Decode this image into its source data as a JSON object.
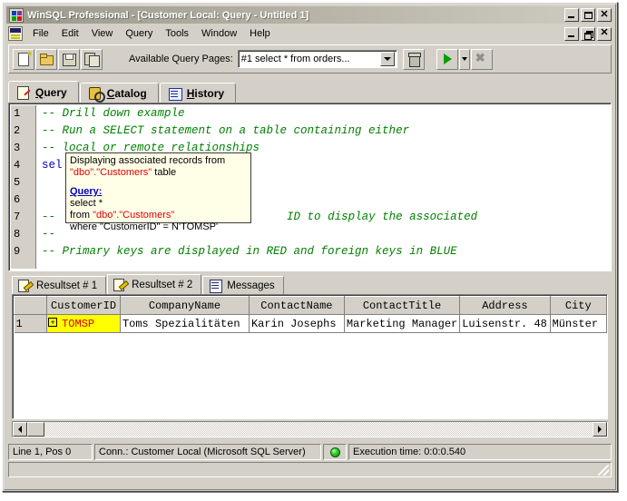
{
  "window": {
    "title": "WinSQL Professional - [Customer Local: Query - Untitled 1]",
    "app_icon": "winsql-app-icon",
    "controls": {
      "minimize": "_",
      "maximize": "□",
      "close": "✕",
      "restore": "❐"
    }
  },
  "menu": {
    "items": [
      {
        "label": "File"
      },
      {
        "label": "Edit"
      },
      {
        "label": "View"
      },
      {
        "label": "Query"
      },
      {
        "label": "Tools"
      },
      {
        "label": "Window"
      },
      {
        "label": "Help"
      }
    ]
  },
  "toolbar": {
    "buttons": [
      {
        "name": "new-query-button",
        "icon": "new-document-icon"
      },
      {
        "name": "open-button",
        "icon": "open-folder-icon"
      },
      {
        "name": "save-button",
        "icon": "save-disk-icon"
      },
      {
        "name": "save-all-button",
        "icon": "save-all-icon"
      }
    ],
    "query_pages_label": "Available Query Pages:",
    "query_pages_value": "#1 select * from orders...",
    "delete_icon": "trash-can-icon",
    "run_icon": "run-play-icon",
    "run_dropdown_icon": "chevron-down-icon",
    "stop_icon": "stop-cancel-icon"
  },
  "tabs": [
    {
      "label": "Query",
      "mnemonic": "Q",
      "rest": "uery",
      "icon": "query-note-icon",
      "active": true
    },
    {
      "label": "Catalog",
      "mnemonic": "C",
      "rest": "atalog",
      "icon": "catalog-search-icon",
      "active": false
    },
    {
      "label": "History",
      "mnemonic": "H",
      "rest": "istory",
      "icon": "history-list-icon",
      "active": false
    }
  ],
  "editor": {
    "line_numbers": [
      "1",
      "2",
      "3",
      "4",
      "5",
      "6",
      "7",
      "8",
      "9"
    ],
    "lines": [
      {
        "n": "1",
        "segments": [
          {
            "cls": "cmt",
            "text": "-- Drill down example"
          }
        ]
      },
      {
        "n": "2",
        "segments": [
          {
            "cls": "cmt",
            "text": "-- Run a SELECT statement on a table containing either"
          }
        ]
      },
      {
        "n": "3",
        "segments": [
          {
            "cls": "cmt",
            "text": "-- local or remote relationships"
          }
        ]
      },
      {
        "n": "4",
        "segments": [
          {
            "cls": "kw",
            "text": "sel"
          }
        ]
      },
      {
        "n": "5",
        "segments": []
      },
      {
        "n": "6",
        "segments": []
      },
      {
        "n": "7",
        "segments": [
          {
            "cls": "cmt",
            "text": "--"
          },
          {
            "cls": "cmt",
            "text": "                                  ID to display the associated"
          }
        ]
      },
      {
        "n": "8",
        "segments": [
          {
            "cls": "cmt",
            "text": "--"
          }
        ]
      },
      {
        "n": "9",
        "segments": [
          {
            "cls": "cmt",
            "text": "-- Primary keys are displayed in RED and foreign keys in BLUE"
          }
        ]
      }
    ]
  },
  "tooltip": {
    "line1_prefix": "Displaying associated records from ",
    "line1_table": "\"dbo\".\"Customers\"",
    "line1_suffix": " table",
    "query_header": "Query:",
    "q1": "select *",
    "q2_prefix": "from ",
    "q2_table": "\"dbo\".\"Customers\"",
    "q3": "where \"CustomerID\" = N'TOMSP'"
  },
  "result_tabs": [
    {
      "label": "Resultset # 1",
      "icon": "resultset-icon",
      "active": false
    },
    {
      "label": "Resultset # 2",
      "icon": "resultset-icon",
      "active": true
    },
    {
      "label": "Messages",
      "icon": "messages-icon",
      "active": false
    }
  ],
  "grid": {
    "columns": [
      "",
      "CustomerID",
      "CompanyName",
      "ContactName",
      "ContactTitle",
      "Address",
      "City"
    ],
    "rows": [
      {
        "row_number": "1",
        "expander": "+",
        "cells": [
          "TOMSP",
          "Toms Spezialitäten",
          "Karin Josephs",
          "Marketing Manager",
          "Luisenstr. 48",
          "Münster"
        ]
      }
    ]
  },
  "status": {
    "cursor": "Line 1, Pos 0",
    "connection": "Conn.: Customer Local (Microsoft SQL Server)",
    "led": "green-status-led",
    "execution_time": "Execution time: 0:0:0.540"
  },
  "colors": {
    "face": "#d4d0c8",
    "comment_green": "#008000",
    "keyword_blue": "#0000c0",
    "primary_key_red": "#e00000",
    "key_cell_yellow": "#ffff00",
    "tooltip_bg": "#ffffe8",
    "led_green": "#2fd02f"
  }
}
